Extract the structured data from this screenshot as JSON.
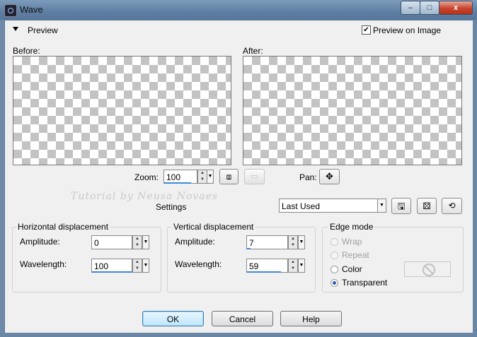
{
  "window": {
    "title": "Wave",
    "minimize_label": "–",
    "maximize_label": "□",
    "close_label": "x"
  },
  "preview": {
    "header_label": "Preview",
    "preview_on_image_label": "Preview on Image",
    "preview_on_image_checked": true,
    "before_label": "Before:",
    "after_label": "After:",
    "zoom_label": "Zoom:",
    "zoom_value": "100",
    "pan_label": "Pan:"
  },
  "watermark": "Tutorial by Neusa Novaes",
  "settings": {
    "label": "Settings",
    "preset_value": "Last Used"
  },
  "horizontal": {
    "title": "Horizontal displacement",
    "amplitude_label": "Amplitude:",
    "amplitude_value": "0",
    "wavelength_label": "Wavelength:",
    "wavelength_value": "100"
  },
  "vertical": {
    "title": "Vertical displacement",
    "amplitude_label": "Amplitude:",
    "amplitude_value": "7",
    "wavelength_label": "Wavelength:",
    "wavelength_value": "59"
  },
  "edge_mode": {
    "title": "Edge mode",
    "options": [
      {
        "label": "Wrap",
        "enabled": false,
        "selected": false
      },
      {
        "label": "Repeat",
        "enabled": false,
        "selected": false
      },
      {
        "label": "Color",
        "enabled": true,
        "selected": false
      },
      {
        "label": "Transparent",
        "enabled": true,
        "selected": true
      }
    ]
  },
  "buttons": {
    "ok": "OK",
    "cancel": "Cancel",
    "help": "Help"
  },
  "icons": [
    "camera-icon",
    "zoom-fit-icon",
    "zoom-actual-icon",
    "pan-icon",
    "save-icon",
    "random-icon",
    "reset-icon",
    "no-color-icon"
  ],
  "colors": {
    "accent": "#3c8ad8",
    "title_bar": "#5e7fa2",
    "dialog_bg": "#f0f0f0"
  }
}
